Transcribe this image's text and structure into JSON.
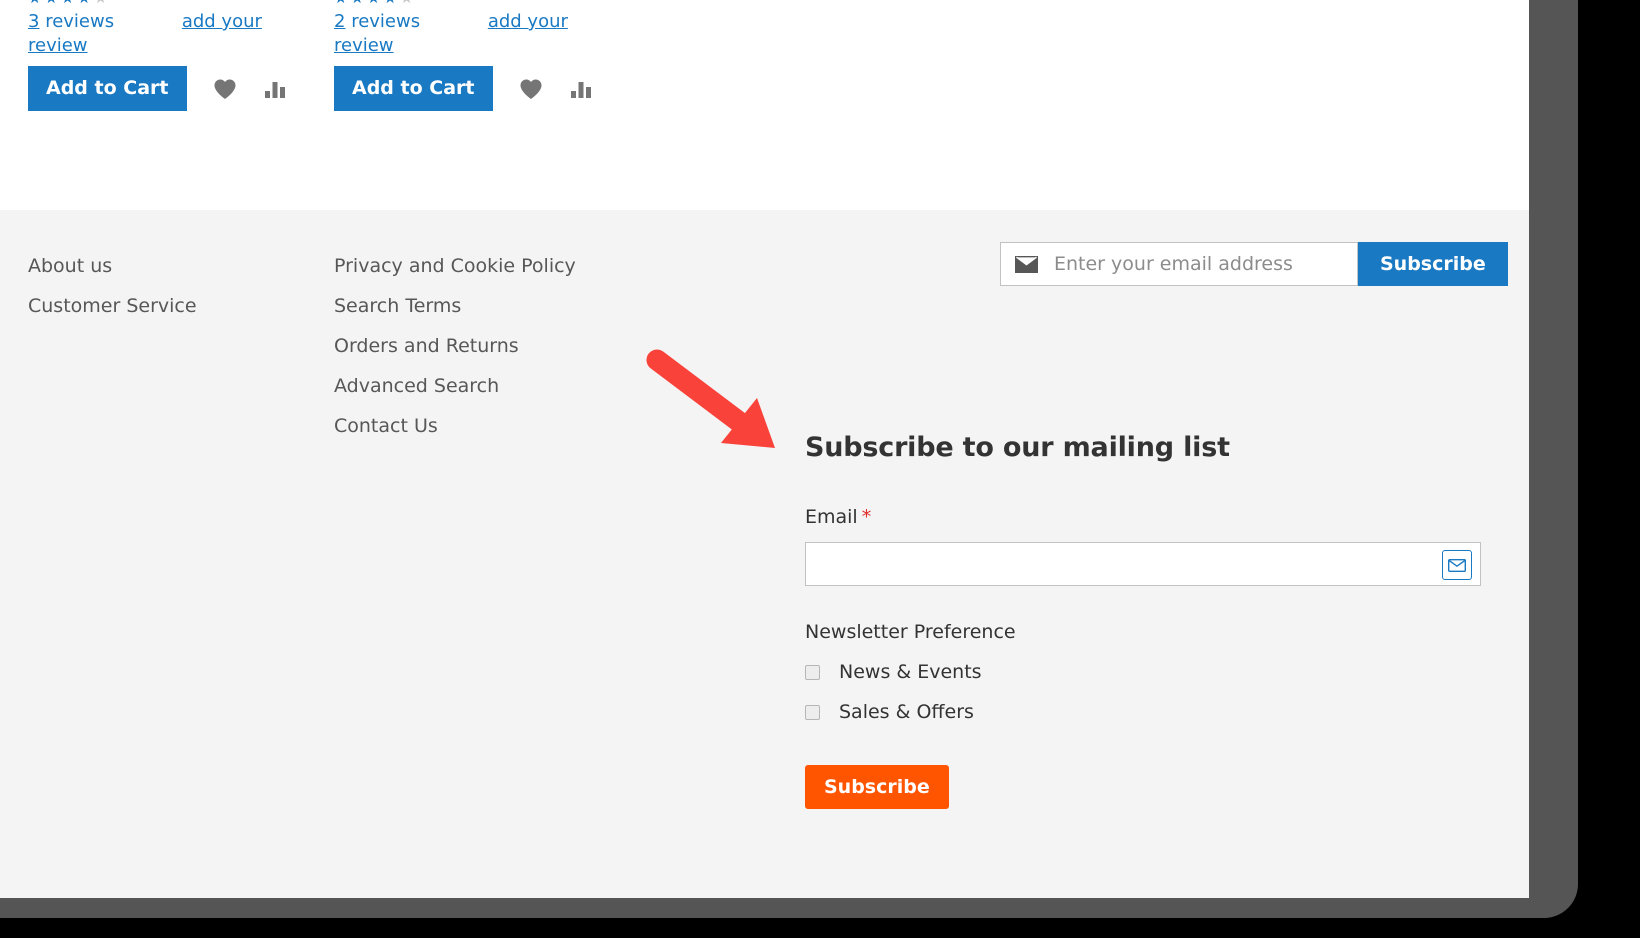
{
  "products": [
    {
      "rating_stars": "★★★★★",
      "review_count": "3",
      "reviews_label": "reviews",
      "add_review_label": "add your review",
      "add_to_cart_label": "Add to Cart",
      "wishlist_icon": "heart-icon",
      "compare_icon": "compare-bars-icon"
    },
    {
      "rating_stars": "★★★★★",
      "review_count": "2",
      "reviews_label": "reviews",
      "add_review_label": "add your review",
      "add_to_cart_label": "Add to Cart",
      "wishlist_icon": "heart-icon",
      "compare_icon": "compare-bars-icon"
    }
  ],
  "footer": {
    "column1": [
      {
        "label": "About us"
      },
      {
        "label": "Customer Service"
      }
    ],
    "column2": [
      {
        "label": "Privacy and Cookie Policy"
      },
      {
        "label": "Search Terms"
      },
      {
        "label": "Orders and Returns"
      },
      {
        "label": "Advanced Search"
      },
      {
        "label": "Contact Us"
      }
    ],
    "newsletter_bar": {
      "icon": "envelope-icon",
      "placeholder": "Enter your email address",
      "value": "",
      "subscribe_label": "Subscribe"
    }
  },
  "mailing_form": {
    "heading": "Subscribe to our mailing list",
    "email_label": "Email",
    "required_marker": "*",
    "email_value": "",
    "email_placeholder": "",
    "email_icon": "envelope-icon",
    "preference_label": "Newsletter Preference",
    "options": [
      {
        "label": "News & Events",
        "checked": false
      },
      {
        "label": "Sales & Offers",
        "checked": false
      }
    ],
    "submit_label": "Subscribe"
  },
  "annotation": {
    "type": "arrow",
    "color": "#f9423a",
    "points_to": "Subscribe to our mailing list"
  },
  "colors": {
    "link_blue": "#1979c3",
    "primary_blue": "#1979c3",
    "accent_orange": "#ff5501",
    "text_dark": "#333333",
    "text_muted": "#575757",
    "footer_bg": "#f4f4f4",
    "page_bg": "#ffffff",
    "bezel": "#555555",
    "arrow_red": "#f9423a"
  }
}
